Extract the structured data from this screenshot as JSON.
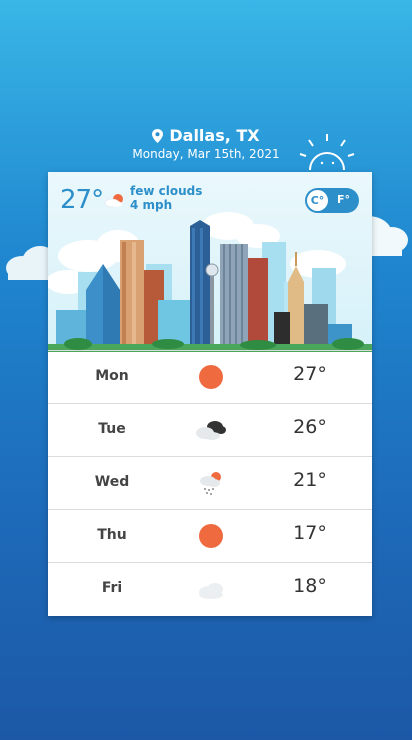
{
  "header": {
    "location": "Dallas, TX",
    "date": "Monday, Mar 15th, 2021"
  },
  "current": {
    "temperature": "27°",
    "condition": "few clouds",
    "wind": "4 mph",
    "icon": "sun-cloud-icon"
  },
  "units": {
    "celsius_label": "C°",
    "fahrenheit_label": "F°",
    "selected": "C°"
  },
  "forecast": [
    {
      "day": "Mon",
      "temp": "27°",
      "icon": "sun-icon"
    },
    {
      "day": "Tue",
      "temp": "26°",
      "icon": "dark-clouds-icon"
    },
    {
      "day": "Wed",
      "temp": "21°",
      "icon": "rain-cloud-icon"
    },
    {
      "day": "Thu",
      "temp": "17°",
      "icon": "sun-icon"
    },
    {
      "day": "Fri",
      "temp": "18°",
      "icon": "cloud-icon"
    }
  ],
  "colors": {
    "accent": "#2d8fca",
    "sun": "#f06a40"
  }
}
